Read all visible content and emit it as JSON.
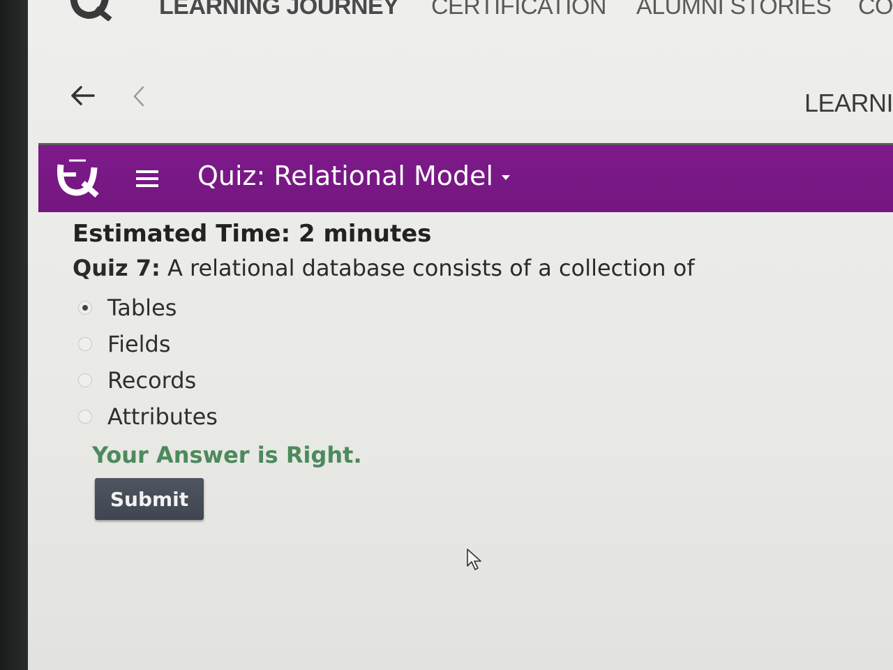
{
  "topnav": {
    "items": [
      {
        "label": "LEARNING JOURNEY"
      },
      {
        "label": "CERTIFICATION"
      },
      {
        "label": "ALUMNI STORIES"
      },
      {
        "label": "CO"
      }
    ],
    "logo_icon": "brand-logo-icon"
  },
  "subnav": {
    "back_icon": "arrow-left-icon",
    "prev_icon": "chevron-left-icon",
    "title": "LEARNI"
  },
  "quiz_header": {
    "title": "Quiz: Relational Model",
    "menu_icon": "hamburger-menu-icon",
    "logo_icon": "quiz-logo-icon",
    "bg_color": "#7d1a8a"
  },
  "quiz": {
    "estimated_time": "Estimated Time: 2 minutes",
    "question_number": "Quiz 7:",
    "question_text": "A relational database consists of a collection of",
    "options": [
      {
        "label": "Tables",
        "selected": true
      },
      {
        "label": "Fields",
        "selected": false
      },
      {
        "label": "Records",
        "selected": false
      },
      {
        "label": "Attributes",
        "selected": false
      }
    ],
    "result": "Your Answer is Right.",
    "result_color": "#4c8a5e",
    "submit_label": "Submit"
  }
}
